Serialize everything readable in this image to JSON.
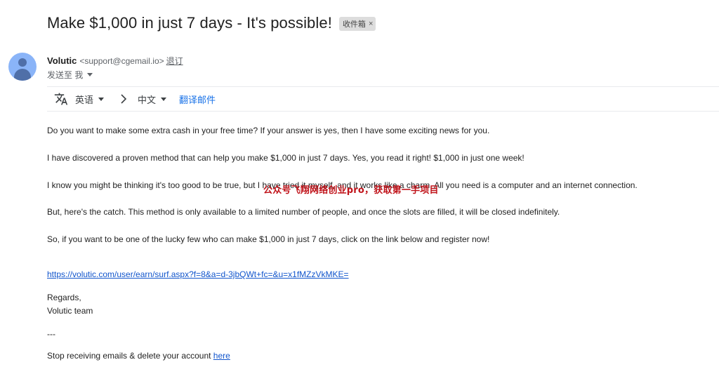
{
  "email": {
    "subject": "Make $1,000 in just 7 days - It's possible!",
    "label": "收件箱",
    "label_close": "×",
    "sender_name": "Volutic",
    "sender_email": "<support@cgemail.io>",
    "unsubscribe": "退订",
    "to_text": "发送至 我"
  },
  "translate_bar": {
    "source_lang": "英语",
    "target_lang": "中文",
    "translate_action": "翻译邮件"
  },
  "body": {
    "p1": "Do you want to make some extra cash in your free time? If your answer is yes, then I have some exciting news for you.",
    "p2": "I have discovered a proven method that can help you make $1,000 in just 7 days. Yes, you read it right! $1,000 in just one week!",
    "p3": "I know you might be thinking it's too good to be true, but I have tried it myself, and it works like a charm. All you need is a computer and an internet connection.",
    "p4": "But, here's the catch. This method is only available to a limited number of people, and once the slots are filled, it will be closed indefinitely.",
    "p5": "So, if you want to be one of the lucky few who can make $1,000 in just 7 days, click on the link below and register now!",
    "link": "https://volutic.com/user/earn/surf.aspx?f=8&a=d-3jbQWt+fc=&u=x1fMZzVkMKE=",
    "regards": "Regards,",
    "team": "Volutic team",
    "dashes": "---",
    "stop_text": "Stop receiving emails & delete your account ",
    "stop_link": "here"
  },
  "watermark": "公众号飞翔网络创业pro，获取第一手项目"
}
